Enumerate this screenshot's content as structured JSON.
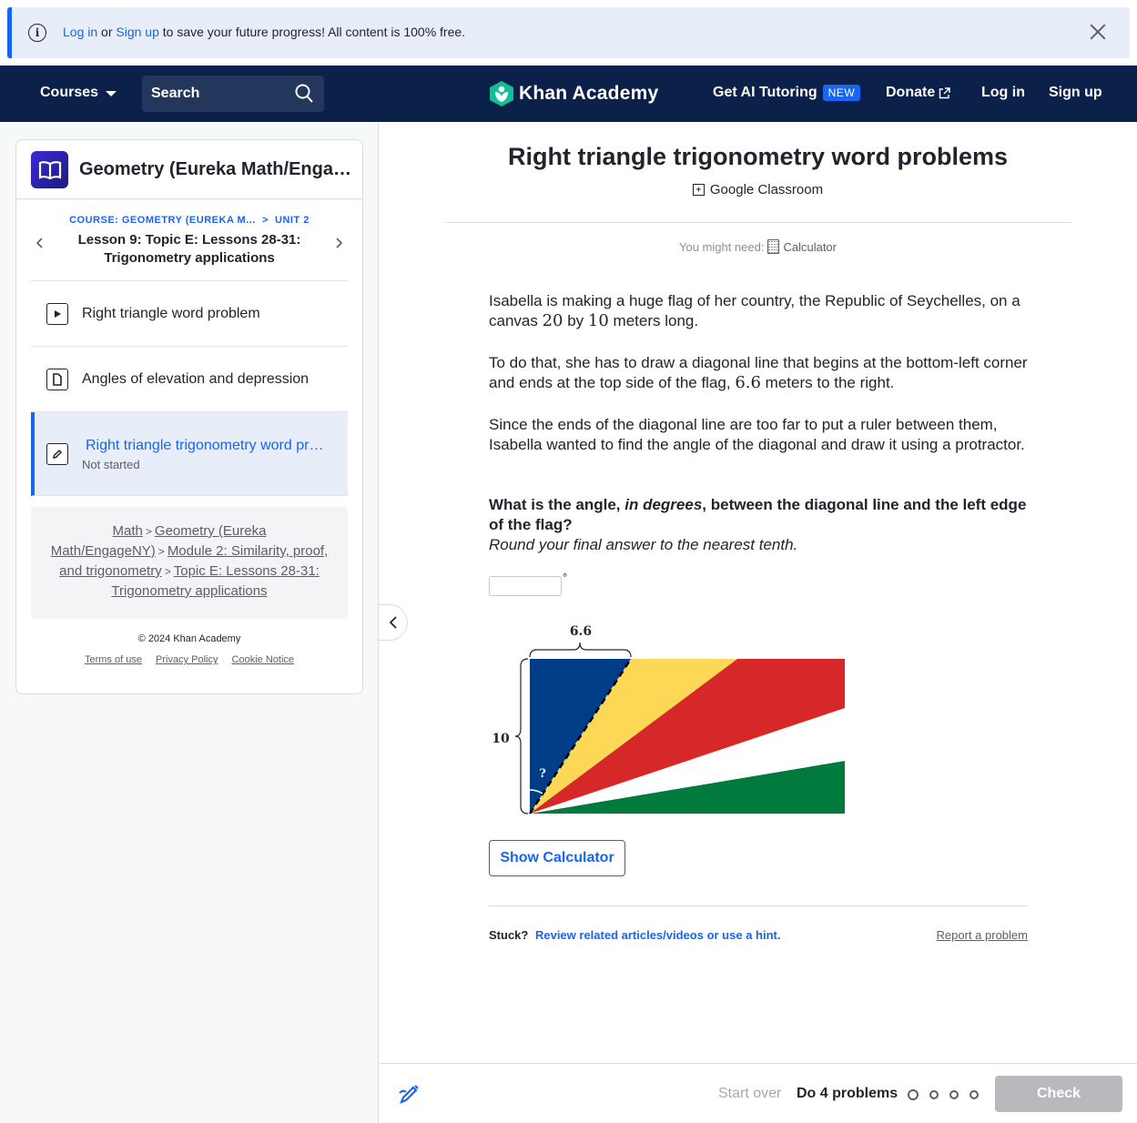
{
  "banner": {
    "login": "Log in",
    "or": "or",
    "signup": "Sign up",
    "message": "to save your future progress! All content is 100% free."
  },
  "nav": {
    "courses": "Courses",
    "search_label": "Search",
    "logo": "Khan Academy",
    "ai_tutoring": "Get AI Tutoring",
    "new_badge": "NEW",
    "donate": "Donate",
    "login": "Log in",
    "signup": "Sign up"
  },
  "sidebar": {
    "course_title": "Geometry (Eureka Math/EngageNY)",
    "breadcrumb_course": "COURSE: GEOMETRY (EUREKA M...",
    "breadcrumb_unit": "UNIT 2",
    "lesson_title": "Lesson 9: Topic E: Lessons 28-31: Trigonometry applications",
    "items": [
      {
        "label": "Right triangle word problem",
        "type": "video"
      },
      {
        "label": "Angles of elevation and depression",
        "type": "article"
      },
      {
        "label": "Right triangle trigonometry word problems",
        "type": "exercise",
        "status": "Not started"
      }
    ],
    "crumbs": [
      "Math",
      "Geometry (Eureka Math/EngageNY)",
      "Module 2: Similarity, proof, and trigonometry",
      "Topic E: Lessons 28-31: Trigonometry applications"
    ],
    "copyright": "© 2024 Khan Academy",
    "footer_links": [
      "Terms of use",
      "Privacy Policy",
      "Cookie Notice"
    ]
  },
  "main": {
    "title": "Right triangle trigonometry word problems",
    "google_classroom": "Google Classroom",
    "you_might_need": "You might need:",
    "calculator": "Calculator",
    "p1_a": "Isabella is making a huge flag of her country, the Republic of Seychelles, on a canvas ",
    "p1_n1": "20",
    "p1_b": " by ",
    "p1_n2": "10",
    "p1_c": " meters long.",
    "p2_a": "To do that, she has to draw a diagonal line that begins at the bottom-left corner and ends at the top side of the flag, ",
    "p2_n": "6.6",
    "p2_b": " meters to the right.",
    "p3": "Since the ends of the diagonal line are too far to put a ruler between them, Isabella wanted to find the angle of the diagonal and draw it using a protractor.",
    "q_a": "What is the angle, ",
    "q_em": "in degrees",
    "q_b": ", between the diagonal line and the left edge of the flag?",
    "round": "Round your final answer to the nearest tenth.",
    "answer_value": "",
    "degree": "°",
    "figure": {
      "top_label": "6.6",
      "left_label": "10",
      "angle_label": "?",
      "colors": {
        "blue": "#003d88",
        "yellow": "#fcd856",
        "red": "#d62828",
        "white": "#ffffff",
        "green": "#007a3d"
      }
    },
    "show_calculator": "Show Calculator",
    "stuck": "Stuck?",
    "stuck_link": "Review related articles/videos or use a hint.",
    "report": "Report a problem"
  },
  "bottom": {
    "start_over": "Start over",
    "do_problems": "Do 4 problems",
    "check": "Check"
  }
}
